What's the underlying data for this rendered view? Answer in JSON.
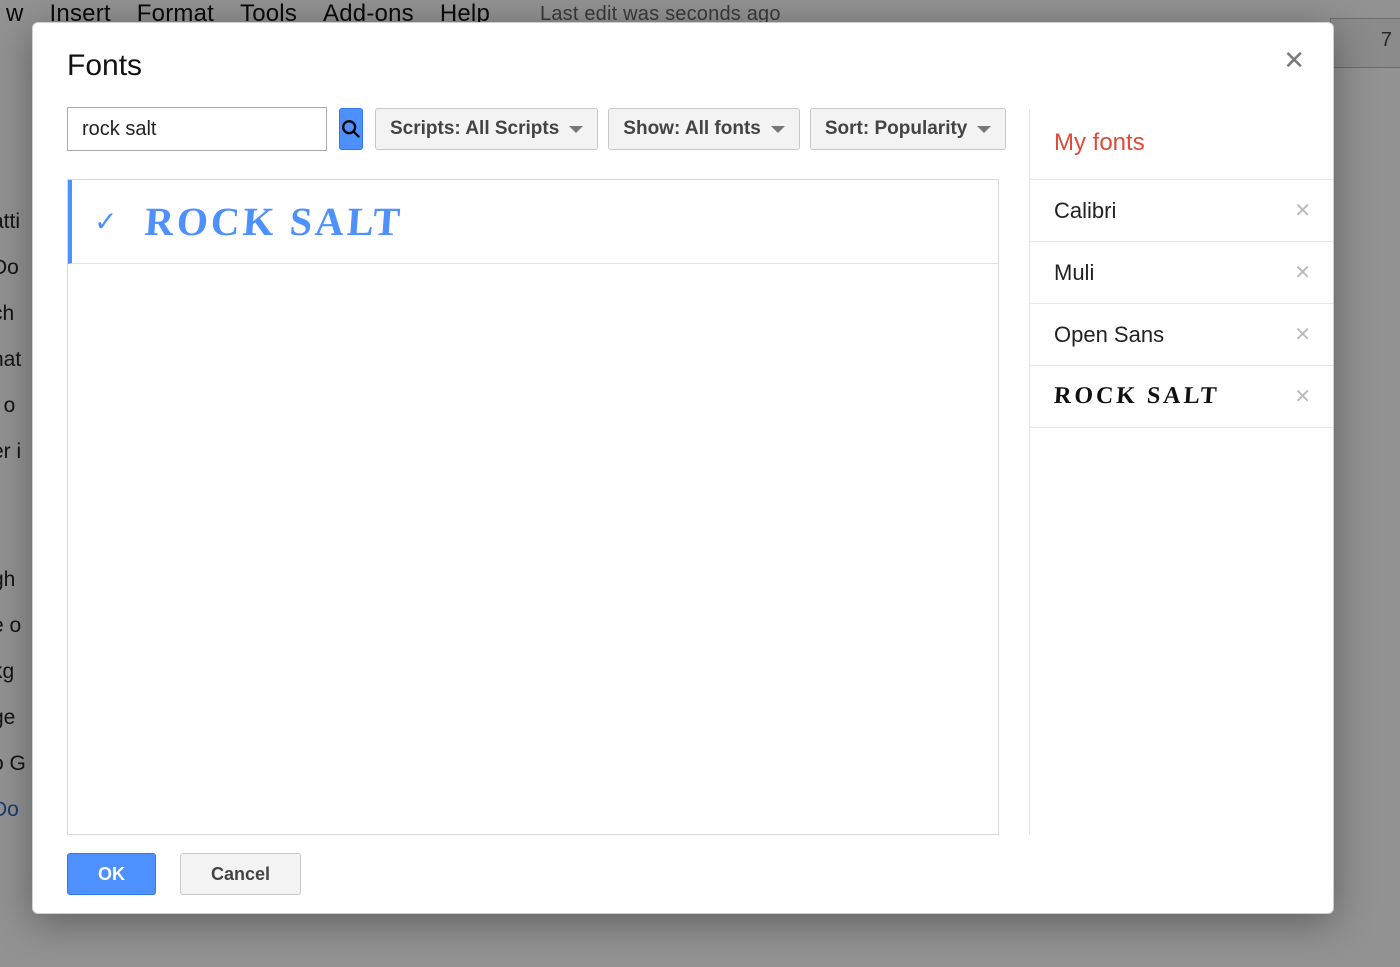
{
  "background": {
    "menu": [
      "w",
      "Insert",
      "Format",
      "Tools",
      "Add-ons",
      "Help"
    ],
    "edit_note": "Last edit was seconds ago",
    "right_tray_value": "7",
    "sidebar_fragments": [
      "atti",
      "Do",
      "ch",
      "hat",
      "t o",
      "er i",
      "gh",
      "e o",
      "kg",
      "ge",
      "o G"
    ],
    "sidebar_link": "Do"
  },
  "dialog": {
    "title": "Fonts",
    "search_value": "rock salt",
    "filters": {
      "scripts_label": "Scripts: All Scripts",
      "show_label": "Show: All fonts",
      "sort_label": "Sort: Popularity"
    },
    "results": [
      {
        "display_name": "Rock Salt",
        "selected": true
      }
    ],
    "sidebar": {
      "title": "My fonts",
      "items": [
        {
          "name": "Calibri",
          "style": "plain"
        },
        {
          "name": "Muli",
          "style": "plain"
        },
        {
          "name": "Open Sans",
          "style": "plain"
        },
        {
          "name": "Rock Salt",
          "style": "rock-salt"
        }
      ]
    },
    "buttons": {
      "ok": "OK",
      "cancel": "Cancel"
    }
  }
}
